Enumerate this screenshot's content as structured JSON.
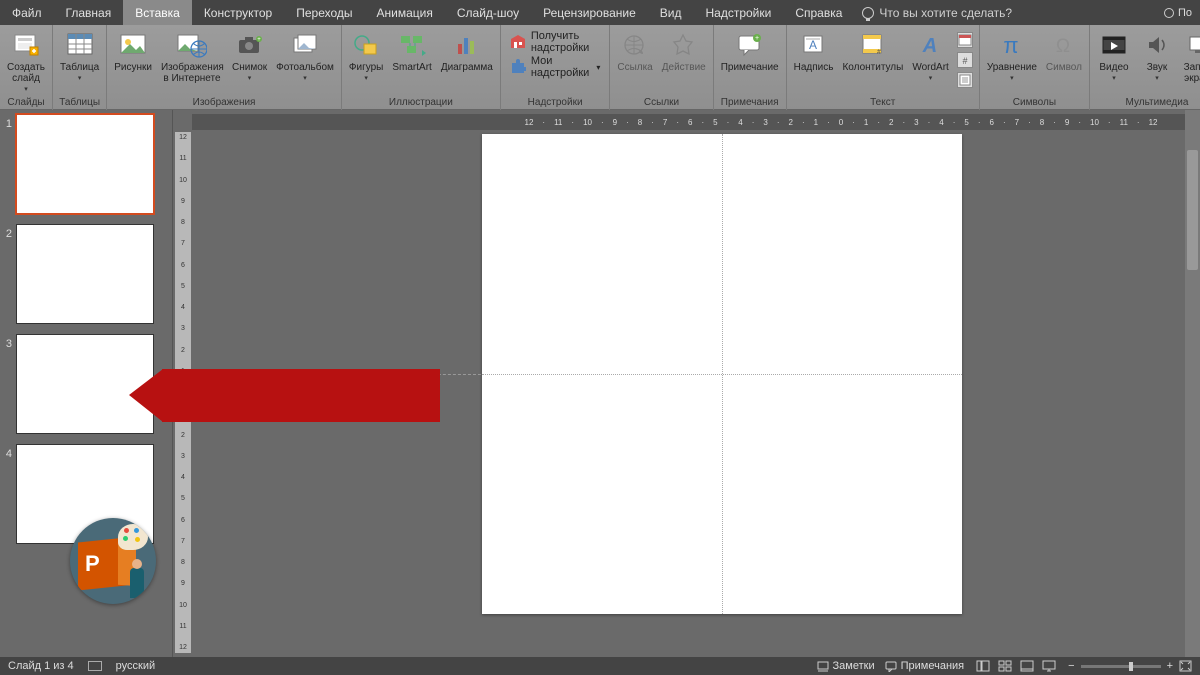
{
  "menu": {
    "tabs": [
      "Файл",
      "Главная",
      "Вставка",
      "Конструктор",
      "Переходы",
      "Анимация",
      "Слайд-шоу",
      "Рецензирование",
      "Вид",
      "Надстройки",
      "Справка"
    ],
    "active_index": 2,
    "tellme": "Что вы хотите сделать?",
    "account_abbrev": "По"
  },
  "ribbon": {
    "groups": {
      "slides": {
        "label": "Слайды",
        "new_slide": "Создать\nслайд"
      },
      "tables": {
        "label": "Таблицы",
        "table": "Таблица"
      },
      "images": {
        "label": "Изображения",
        "pictures": "Рисунки",
        "online": "Изображения\nв Интернете",
        "screenshot": "Снимок",
        "album": "Фотоальбом"
      },
      "illus": {
        "label": "Иллюстрации",
        "shapes": "Фигуры",
        "smartart": "SmartArt",
        "chart": "Диаграмма"
      },
      "addins": {
        "label": "Надстройки",
        "get": "Получить надстройки",
        "my": "Мои надстройки"
      },
      "links": {
        "label": "Ссылки",
        "link": "Ссылка",
        "action": "Действие"
      },
      "comments": {
        "label": "Примечания",
        "comment": "Примечание"
      },
      "text": {
        "label": "Текст",
        "textbox": "Надпись",
        "headerfooter": "Колонтитулы",
        "wordart": "WordArt"
      },
      "symbols": {
        "label": "Символы",
        "equation": "Уравнение",
        "symbol": "Символ"
      },
      "media": {
        "label": "Мультимедиа",
        "video": "Видео",
        "audio": "Звук",
        "screenrec": "Запись\nэкрана"
      }
    }
  },
  "ruler_ticks": [
    "12",
    "11",
    "10",
    "9",
    "8",
    "7",
    "6",
    "5",
    "4",
    "3",
    "2",
    "1",
    "0",
    "1",
    "2",
    "3",
    "4",
    "5",
    "6",
    "7",
    "8",
    "9",
    "10",
    "11",
    "12"
  ],
  "thumbnails": [
    1,
    2,
    3,
    4
  ],
  "selected_thumb": 1,
  "status": {
    "slide_of": "Слайд 1 из 4",
    "language": "русский",
    "notes": "Заметки",
    "comments": "Примечания"
  }
}
